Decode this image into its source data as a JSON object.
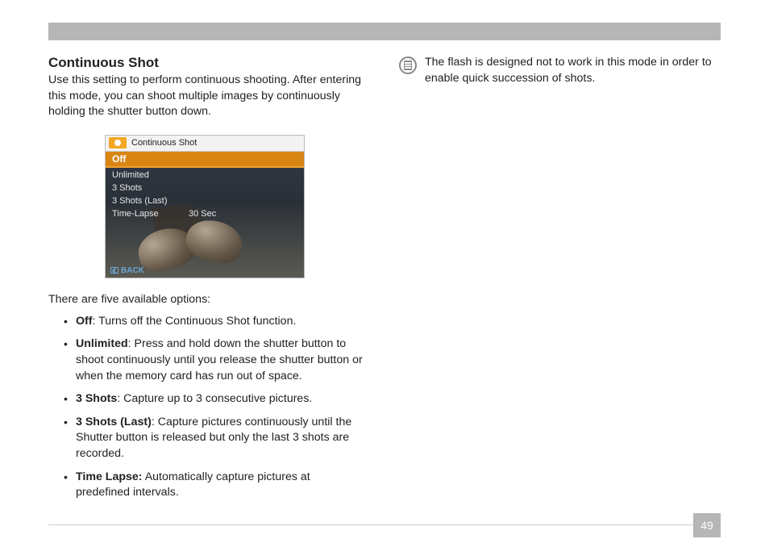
{
  "page_number": "49",
  "heading": "Continuous Shot",
  "intro": "Use this setting to perform continuous shooting. After entering this mode, you can shoot multiple images by continuously holding the shutter button down.",
  "screenshot": {
    "title": "Continuous Shot",
    "selected": "Off",
    "items": [
      {
        "label": "Unlimited",
        "value": ""
      },
      {
        "label": "3 Shots",
        "value": ""
      },
      {
        "label": "3 Shots (Last)",
        "value": ""
      },
      {
        "label": "Time-Lapse",
        "value": "30 Sec"
      }
    ],
    "back": "BACK"
  },
  "subhead": "There are five available options:",
  "options": [
    {
      "term": "Off",
      "desc": ": Turns off the Continuous Shot function."
    },
    {
      "term": "Unlimited",
      "desc": ": Press and hold down the shutter button to shoot continuously until you release the shutter button or when the memory card has run out of space."
    },
    {
      "term": "3 Shots",
      "desc": ": Capture up to 3 consecutive pictures."
    },
    {
      "term": "3 Shots (Last)",
      "desc": ": Capture pictures continuously until the Shutter button is released but only the last 3 shots are recorded."
    },
    {
      "term": "Time Lapse:",
      "desc": " Automatically capture pictures at predefined intervals."
    }
  ],
  "note": "The flash is designed not to work in this mode in order to enable quick succession of shots."
}
